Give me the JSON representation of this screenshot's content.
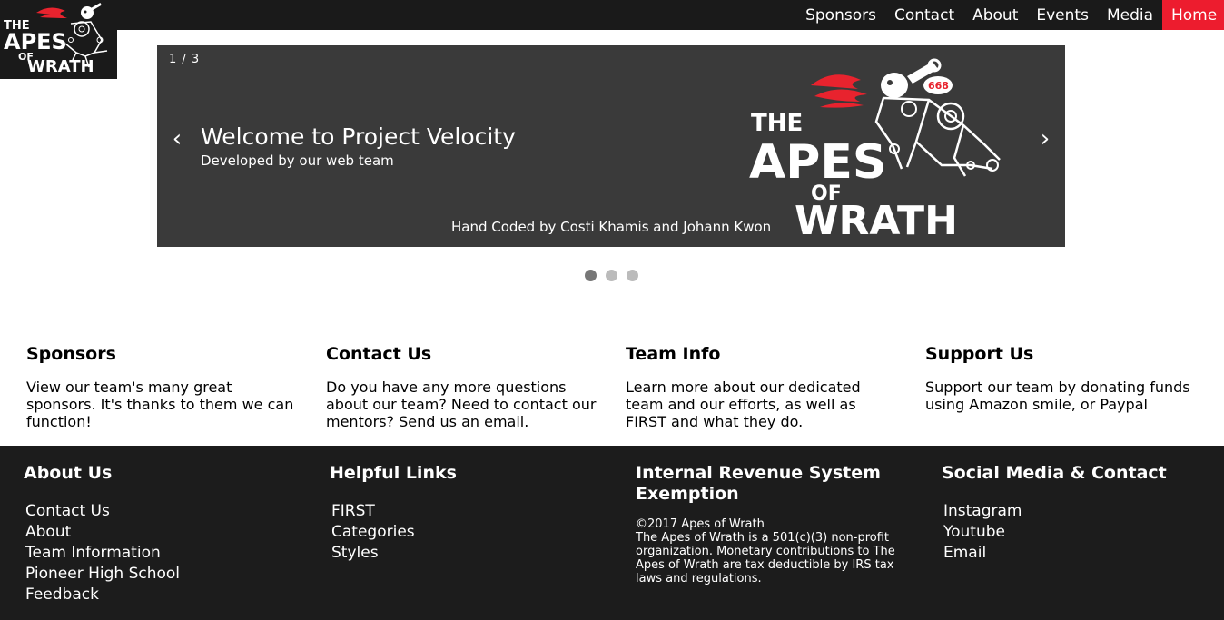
{
  "nav": {
    "items": [
      "Sponsors",
      "Contact",
      "About",
      "Events",
      "Media"
    ],
    "active": "Home"
  },
  "logo": {
    "line1": "THE",
    "line2": "APES",
    "line3": "OF",
    "line4": "WRATH",
    "number": "668"
  },
  "carousel": {
    "counter": "1 / 3",
    "prev_label": "‹",
    "next_label": "›",
    "title": "Welcome to Project Velocity",
    "subtitle": "Developed by our web team",
    "credit": "Hand Coded by Costi Khamis and Johann Kwon",
    "slides_total": 3,
    "active_slide": 1
  },
  "features": [
    {
      "title": "Sponsors",
      "text": "View our team's many great sponsors. It's thanks to them we can function!"
    },
    {
      "title": "Contact Us",
      "text": "Do you have any more questions about our team? Need to contact our mentors? Send us an email."
    },
    {
      "title": "Team Info",
      "text": "Learn more about our dedicated team and our efforts, as well as FIRST and what they do."
    },
    {
      "title": "Support Us",
      "text": "Support our team by donating funds using Amazon smile, or Paypal"
    }
  ],
  "footer": {
    "about": {
      "title": "About Us",
      "links": [
        "Contact Us",
        "About",
        "Team Information",
        "Pioneer High School",
        "Feedback"
      ]
    },
    "helpful": {
      "title": "Helpful Links",
      "links": [
        "FIRST",
        "Categories",
        "Styles"
      ]
    },
    "irs": {
      "title_line1": "Internal Revenue System",
      "title_line2": "Exemption",
      "copyright": "©2017 Apes of Wrath",
      "text": "The Apes of Wrath is a 501(c)(3) non-profit organization. Monetary contributions to The Apes of Wrath are tax deductible by IRS tax laws and regulations."
    },
    "social": {
      "title": "Social Media & Contact",
      "links": [
        "Instagram",
        "Youtube",
        "Email"
      ]
    }
  },
  "colors": {
    "nav_bg": "#1a1a1a",
    "accent": "#ed1c2e",
    "slider_bg": "#3a3a3a",
    "footer_bg": "#1c1c1c"
  }
}
